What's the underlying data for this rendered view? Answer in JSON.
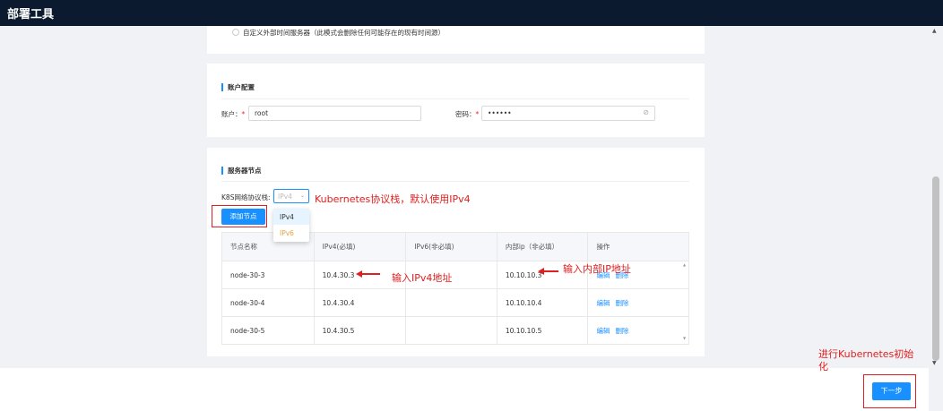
{
  "header": {
    "title": "部署工具"
  },
  "time_section": {
    "radio_label": "自定义外部时间服务器（此模式会删除任何可能存在的现有时间源）"
  },
  "account": {
    "section_title": "账户配置",
    "user_label": "账户：",
    "user_value": "root",
    "password_label": "密码：",
    "password_value": "••••••",
    "required_mark": "*"
  },
  "nodes": {
    "section_title": "服务器节点",
    "protocol_label": "K8S网络协议栈:",
    "protocol_value": "IPv4",
    "protocol_options": [
      "IPv4",
      "IPv6"
    ],
    "add_button": "添加节点",
    "columns": [
      "节点名称",
      "IPv4(必填)",
      "IPv6(非必填)",
      "内部ip（非必填）",
      "操作"
    ],
    "rows": [
      {
        "name": "node-30-3",
        "ipv4": "10.4.30.3",
        "ipv6": "",
        "internal": "10.10.10.3",
        "edit": "编辑",
        "delete": "删除"
      },
      {
        "name": "node-30-4",
        "ipv4": "10.4.30.4",
        "ipv6": "",
        "internal": "10.10.10.4",
        "edit": "编辑",
        "delete": "删除"
      },
      {
        "name": "node-30-5",
        "ipv4": "10.4.30.5",
        "ipv6": "",
        "internal": "10.10.10.5",
        "edit": "编辑",
        "delete": "删除"
      }
    ]
  },
  "footer": {
    "next_button": "下一步"
  },
  "annotations": {
    "protocol_note": "Kubernetes协议栈，默认使用IPv4",
    "ipv4_note": "输入IPv4地址",
    "internal_note": "输入内部IP地址",
    "init_note_line1": "进行Kubernetes初始",
    "init_note_line2": "化"
  },
  "colors": {
    "primary": "#1890ff",
    "annotation": "#e02020",
    "topbar": "#0b1a2e"
  }
}
